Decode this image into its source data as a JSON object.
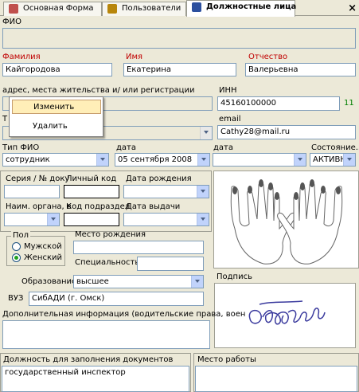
{
  "tabs": [
    {
      "label": "Основная Форма"
    },
    {
      "label": "Пользователи"
    },
    {
      "label": "Должностные лица"
    }
  ],
  "close_label": "×",
  "fio": {
    "label": "ФИО",
    "value": ""
  },
  "surname": {
    "label": "Фамилия",
    "value": "Кайгородова"
  },
  "name": {
    "label": "Имя",
    "value": "Екатерина"
  },
  "patronymic": {
    "label": "Отчество",
    "value": "Валерьевна"
  },
  "address": {
    "label": "адрес, места жительства и/ или регистрации"
  },
  "inn": {
    "label": "ИНН",
    "value": "45160100000",
    "count": "11"
  },
  "context_menu": {
    "items": [
      "Изменить",
      "Удалить"
    ]
  },
  "phone_label_fragment": "Т",
  "email": {
    "label": "email",
    "value": "Cathy28@mail.ru"
  },
  "row_fio_type": {
    "type_label": "Тип ФИО",
    "type_value": "сотрудник",
    "date1_label": "дата",
    "date1_value": "05 сентября 2008",
    "date2_label": "дата",
    "date2_value": "",
    "state_label": "Состояние...",
    "state_value": "АКТИВНІ"
  },
  "passport": {
    "series_label": "Серия / № доку",
    "code_label": "Личный код",
    "birth_label": "Дата рождения",
    "org_label": "Наим. органа, в",
    "dept_label": "Код подраздел",
    "issue_label": "Дата выдачи"
  },
  "gender": {
    "label": "Пол",
    "options": [
      "Мужской",
      "Женский"
    ],
    "selected": "Женский"
  },
  "birthplace": {
    "label": "Место рождения"
  },
  "specialty": {
    "label": "Специальность"
  },
  "education": {
    "label": "Образование",
    "value": "высшее"
  },
  "university": {
    "label": "ВУЗ",
    "value": "СибАДИ (г. Омск)"
  },
  "signature": {
    "label": "Подпись"
  },
  "additional": {
    "label": "Дополнительная информация (водительские права, воен"
  },
  "position": {
    "label": "Должность для заполнения документов",
    "value": "государственный инспектор"
  },
  "workplace": {
    "label": "Место работы"
  },
  "colors": {
    "required": "#c00000",
    "inn_count": "#008000",
    "menu_highlight": "#ffeeb8"
  }
}
